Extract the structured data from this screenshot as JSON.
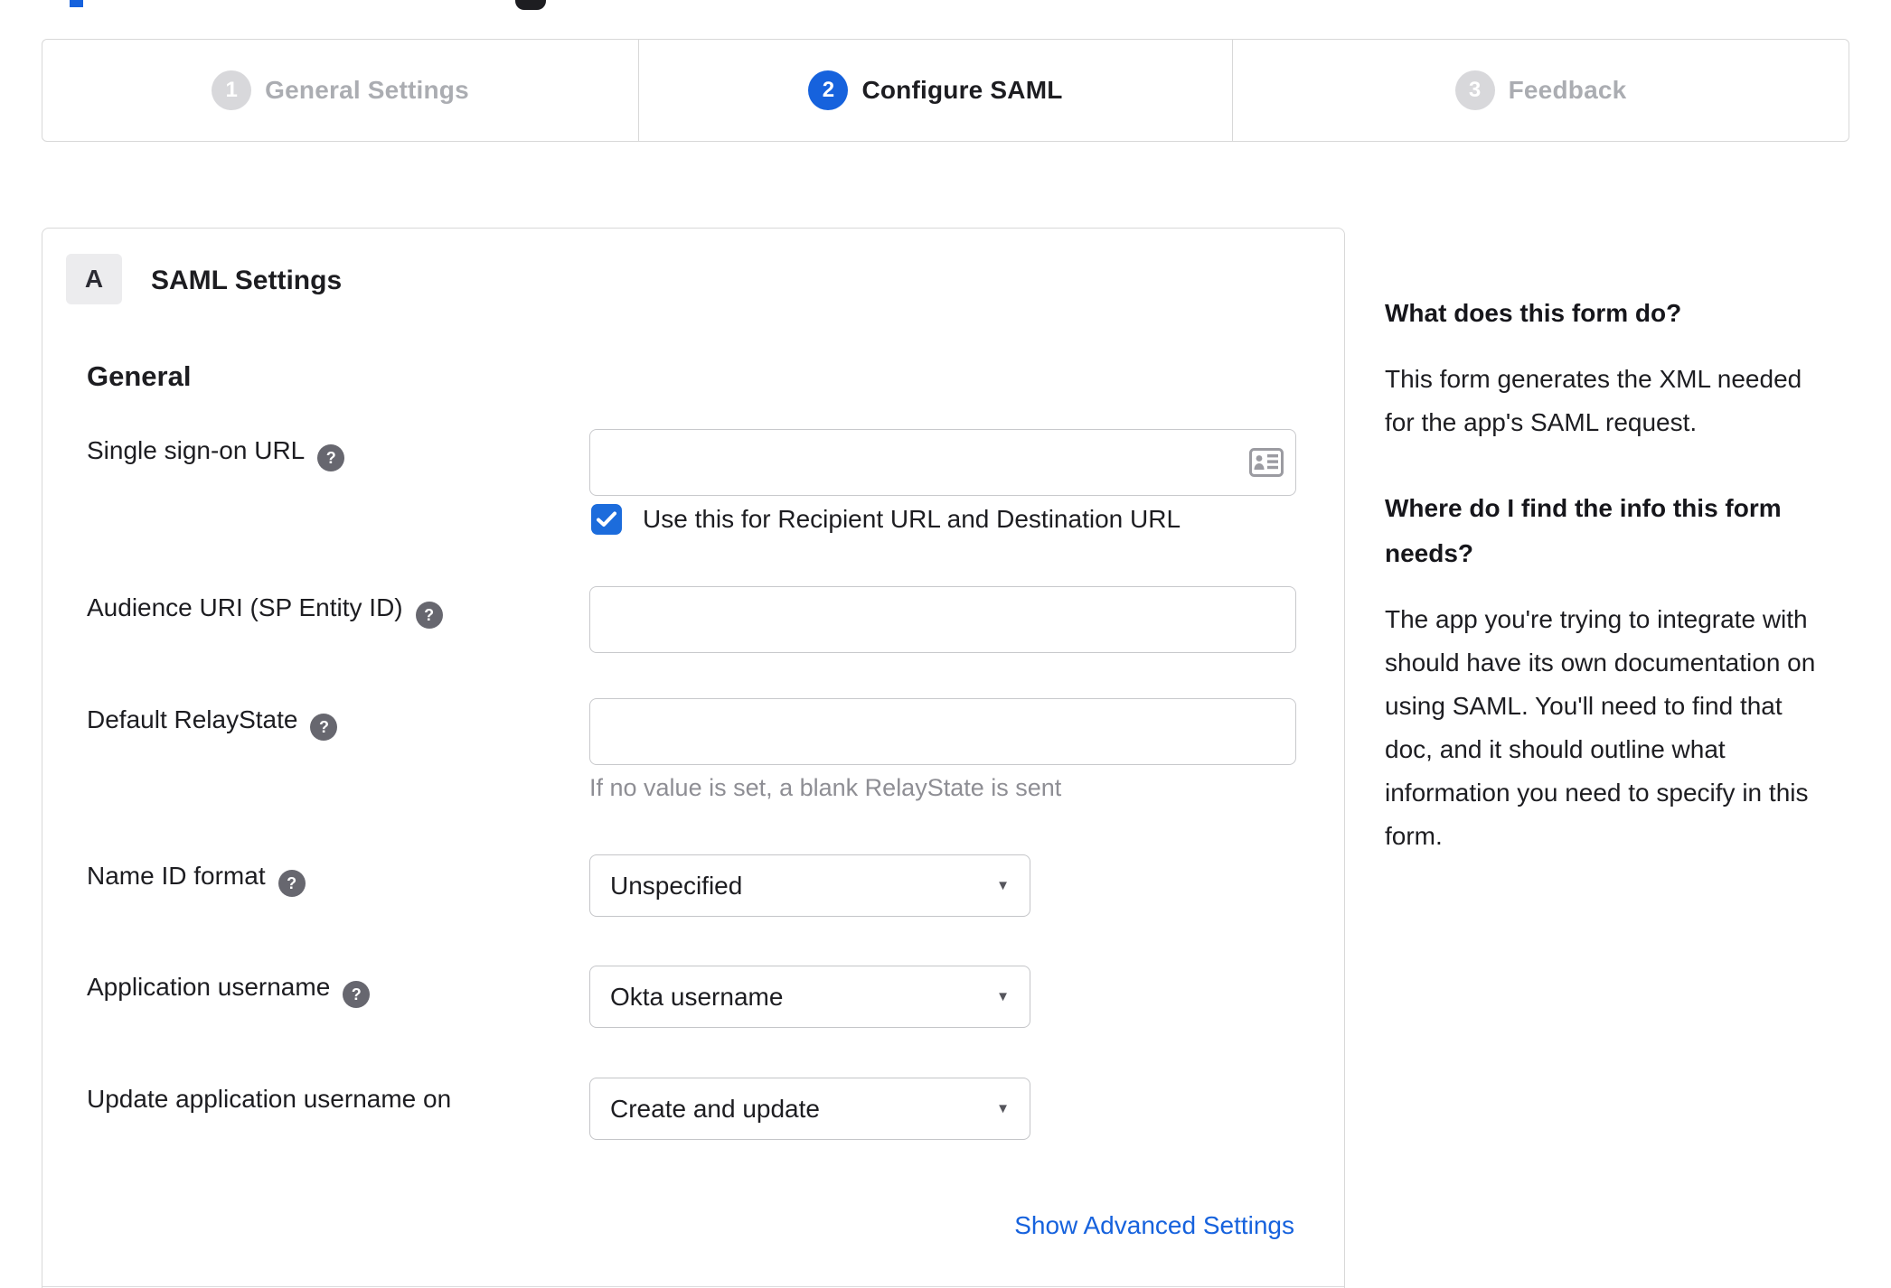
{
  "stepper": {
    "steps": [
      {
        "number": "1",
        "label": "General Settings",
        "state": "inactive"
      },
      {
        "number": "2",
        "label": "Configure SAML",
        "state": "active"
      },
      {
        "number": "3",
        "label": "Feedback",
        "state": "inactive"
      }
    ]
  },
  "panel": {
    "section_badge": "A",
    "section_title": "SAML Settings",
    "subsection_title": "General",
    "fields": [
      {
        "label": "Single sign-on URL",
        "has_help": true,
        "type": "text",
        "value": "",
        "icon": "contact-card-icon"
      },
      {
        "label": "Audience URI (SP Entity ID)",
        "has_help": true,
        "type": "text",
        "value": ""
      },
      {
        "label": "Default RelayState",
        "has_help": true,
        "type": "text",
        "value": "",
        "helper": "If no value is set, a blank RelayState is sent"
      },
      {
        "label": "Name ID format",
        "has_help": true,
        "type": "select",
        "value": "Unspecified"
      },
      {
        "label": "Application username",
        "has_help": true,
        "type": "select",
        "value": "Okta username"
      },
      {
        "label": "Update application username on",
        "has_help": false,
        "type": "select",
        "value": "Create and update"
      }
    ],
    "checkbox": {
      "checked": true,
      "label": "Use this for Recipient URL and Destination URL"
    },
    "advanced_link": "Show Advanced Settings"
  },
  "sidebar": {
    "heading1": "What does this form do?",
    "paragraph1": "This form generates the XML needed\nfor the app's SAML request.",
    "heading2": "Where do I find the info this form\nneeds?",
    "paragraph2": "The app you're trying to integrate with\nshould have its own documentation on\nusing SAML. You'll need to find that\ndoc, and it should outline what\ninformation you need to specify in this\nform."
  },
  "colors": {
    "accent_blue": "#1662dd",
    "checkbox_blue": "#1c6cdc",
    "inactive_gray": "#d8d8db",
    "border_gray": "#d8d8d8",
    "helper_gray": "#8e8e94"
  }
}
